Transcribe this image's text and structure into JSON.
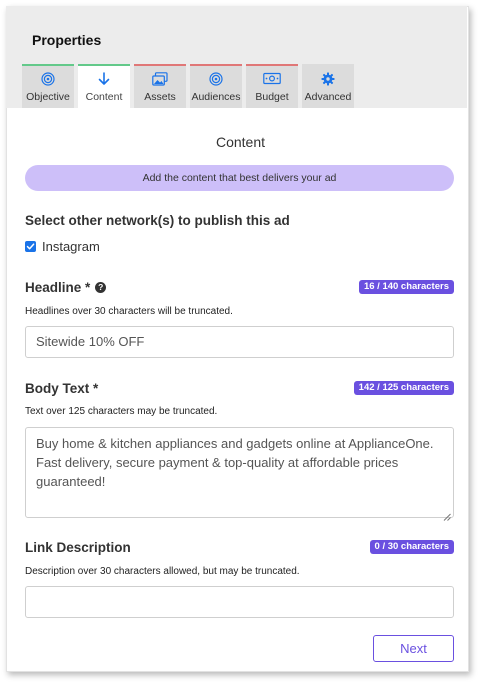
{
  "panel": {
    "title": "Properties"
  },
  "tabs": [
    {
      "label": "Objective",
      "icon": "target-icon",
      "status": "complete"
    },
    {
      "label": "Content",
      "icon": "arrow-down-icon",
      "status": "active"
    },
    {
      "label": "Assets",
      "icon": "images-icon",
      "status": "incomplete"
    },
    {
      "label": "Audiences",
      "icon": "target-icon",
      "status": "incomplete"
    },
    {
      "label": "Budget",
      "icon": "money-icon",
      "status": "incomplete"
    },
    {
      "label": "Advanced",
      "icon": "gear-icon",
      "status": "neutral"
    }
  ],
  "content": {
    "title": "Content",
    "banner": "Add the content that best delivers your ad",
    "networks": {
      "label": "Select other network(s) to publish this ad",
      "option_label": "Instagram",
      "checked": true
    },
    "headline": {
      "label": "Headline *",
      "counter": "16 / 140 characters",
      "hint": "Headlines over 30 characters will be truncated.",
      "value": "Sitewide 10% OFF"
    },
    "body_text": {
      "label": "Body Text *",
      "counter": "142 / 125 characters",
      "hint": "Text over 125 characters may be truncated.",
      "lines": [
        "Buy home & kitchen appliances and gadgets online at ApplianceOne.",
        "Fast delivery, secure payment & top-quality at affordable prices",
        "guaranteed!"
      ]
    },
    "link_description": {
      "label": "Link Description",
      "counter": "0 / 30 characters",
      "hint": "Description over 30 characters allowed, but may be truncated.",
      "value": ""
    },
    "next_label": "Next"
  },
  "colors": {
    "accent": "#6a50e0",
    "banner": "#cdbff9",
    "tab_complete": "#63c98a",
    "tab_incomplete": "#e07777",
    "icon_blue": "#1a73e8"
  }
}
